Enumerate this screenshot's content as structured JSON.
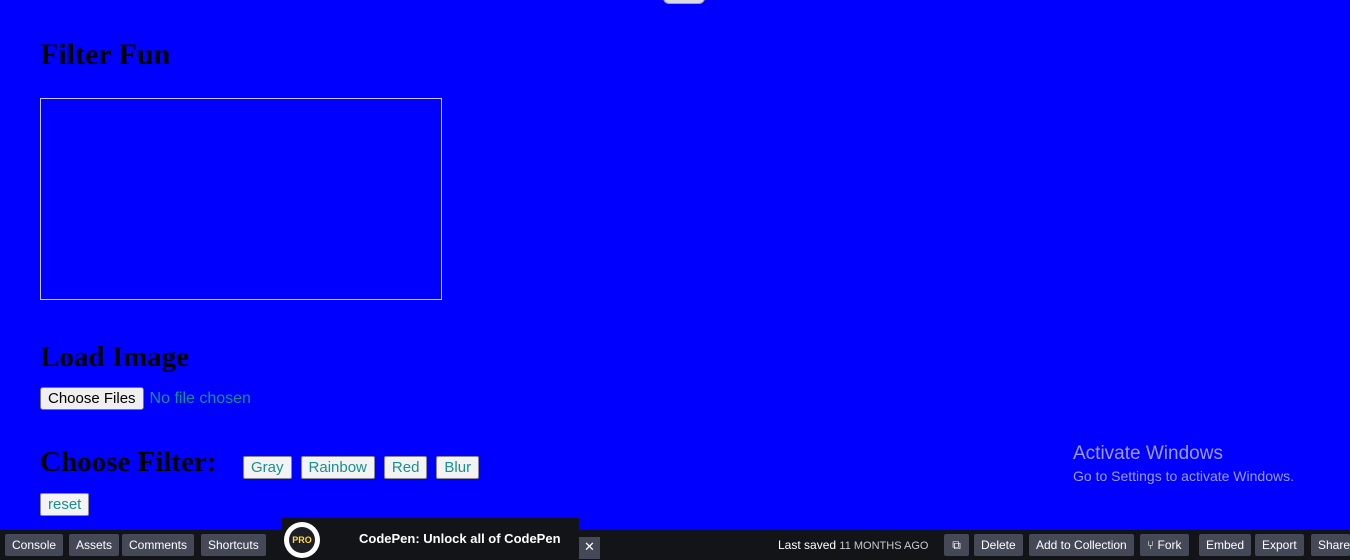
{
  "page": {
    "title": "Filter Fun",
    "load_heading": "Load Image",
    "choose_files_label": "Choose Files",
    "no_file_text": "No file chosen",
    "filter_heading": "Choose Filter:",
    "filters": [
      "Gray",
      "Rainbow",
      "Red",
      "Blur"
    ],
    "reset_label": "reset"
  },
  "watermark": {
    "title": "Activate Windows",
    "subtitle": "Go to Settings to activate Windows."
  },
  "footer": {
    "left_buttons": [
      "Console",
      "Assets",
      "Comments",
      "Shortcuts"
    ],
    "promo": {
      "logo_text": "PRO",
      "text": "CodePen: Unlock all of CodePen",
      "close": "✕"
    },
    "saved_prefix": "Last saved",
    "saved_ago": "11 months ago",
    "right_buttons": {
      "open": "⧉",
      "delete": "Delete",
      "add_collection": "Add to Collection",
      "fork_icon": "⑂",
      "fork": "Fork",
      "embed": "Embed",
      "export": "Export",
      "share": "Share"
    }
  },
  "colors": {
    "background": "#0000ff",
    "footer": "#131417",
    "button_dark": "#444857",
    "teal_text": "#1a8f8f"
  }
}
